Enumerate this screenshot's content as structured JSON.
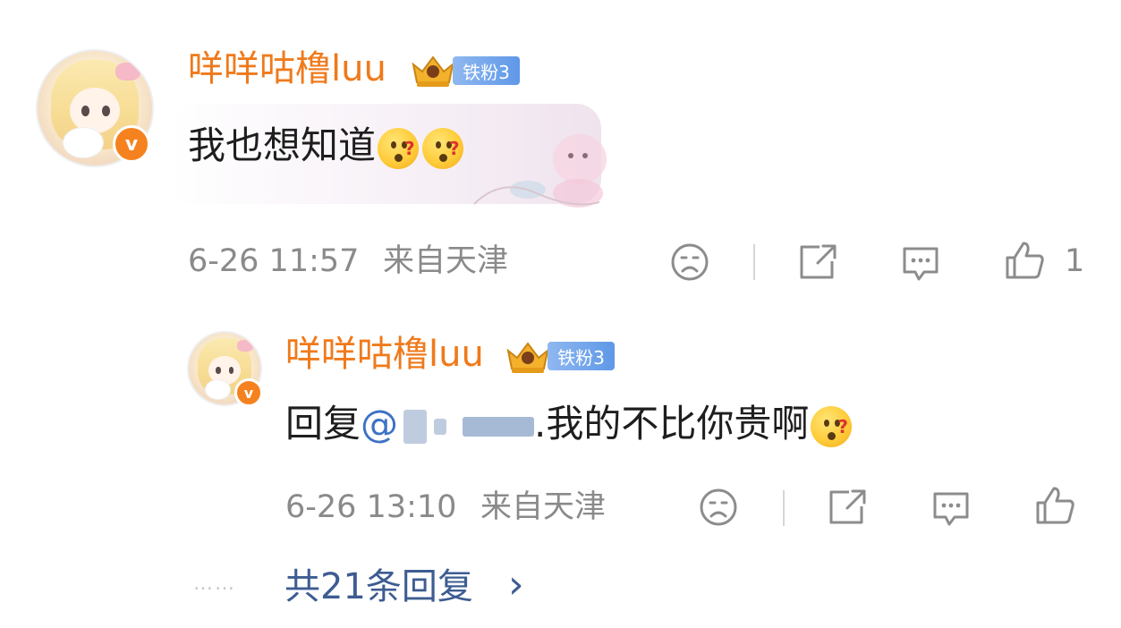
{
  "comment": {
    "username": "咩咩咕橹luu",
    "fan_badge": "铁粉3",
    "content": "我也想知道",
    "emojis": [
      "confused-emoji",
      "confused-emoji"
    ],
    "time": "6-26 11:57",
    "location": "来自天津",
    "like_count": "1"
  },
  "reply": {
    "username": "咩咩咕橹luu",
    "fan_badge": "铁粉3",
    "prefix": "回复",
    "mention": "@",
    "content": ".我的不比你贵啊",
    "emojis": [
      "confused-emoji"
    ],
    "time": "6-26 13:10",
    "location": "来自天津"
  },
  "replies_link": {
    "dots": "……",
    "label": "共21条回复",
    "chevron": "›"
  },
  "colors": {
    "username": "#ef7a1b",
    "verified": "#f5821f",
    "mention": "#3d72c6",
    "meta": "#8a8a8a",
    "link": "#3d5c91"
  }
}
